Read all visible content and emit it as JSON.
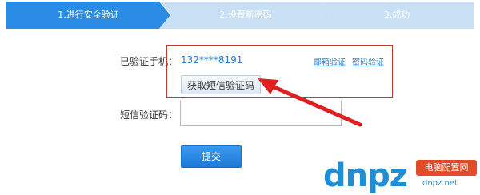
{
  "steps": [
    {
      "label": "1.进行安全验证",
      "state": "active"
    },
    {
      "label": "2.设置新密码",
      "state": "pending"
    },
    {
      "label": "3.成功",
      "state": "pending"
    }
  ],
  "form": {
    "verified_phone_label": "已验证手机：",
    "phone_masked": "132****8191",
    "email_verify_link": "邮箱验证",
    "password_verify_link": "密码验证",
    "get_sms_button": "获取短信验证码",
    "sms_code_label": "短信验证码：",
    "sms_code_value": "",
    "submit_button": "提交"
  },
  "watermark": {
    "logo_text": "dnpz",
    "badge": "电脑配置网",
    "url": "dnpz.net"
  },
  "colors": {
    "step_active": "#2a8ce4",
    "step_pending": "#c9dff4",
    "link": "#2a7bd0",
    "highlight_border": "#c0392b",
    "arrow": "#e02020",
    "submit_bg": "#1e78d6"
  }
}
